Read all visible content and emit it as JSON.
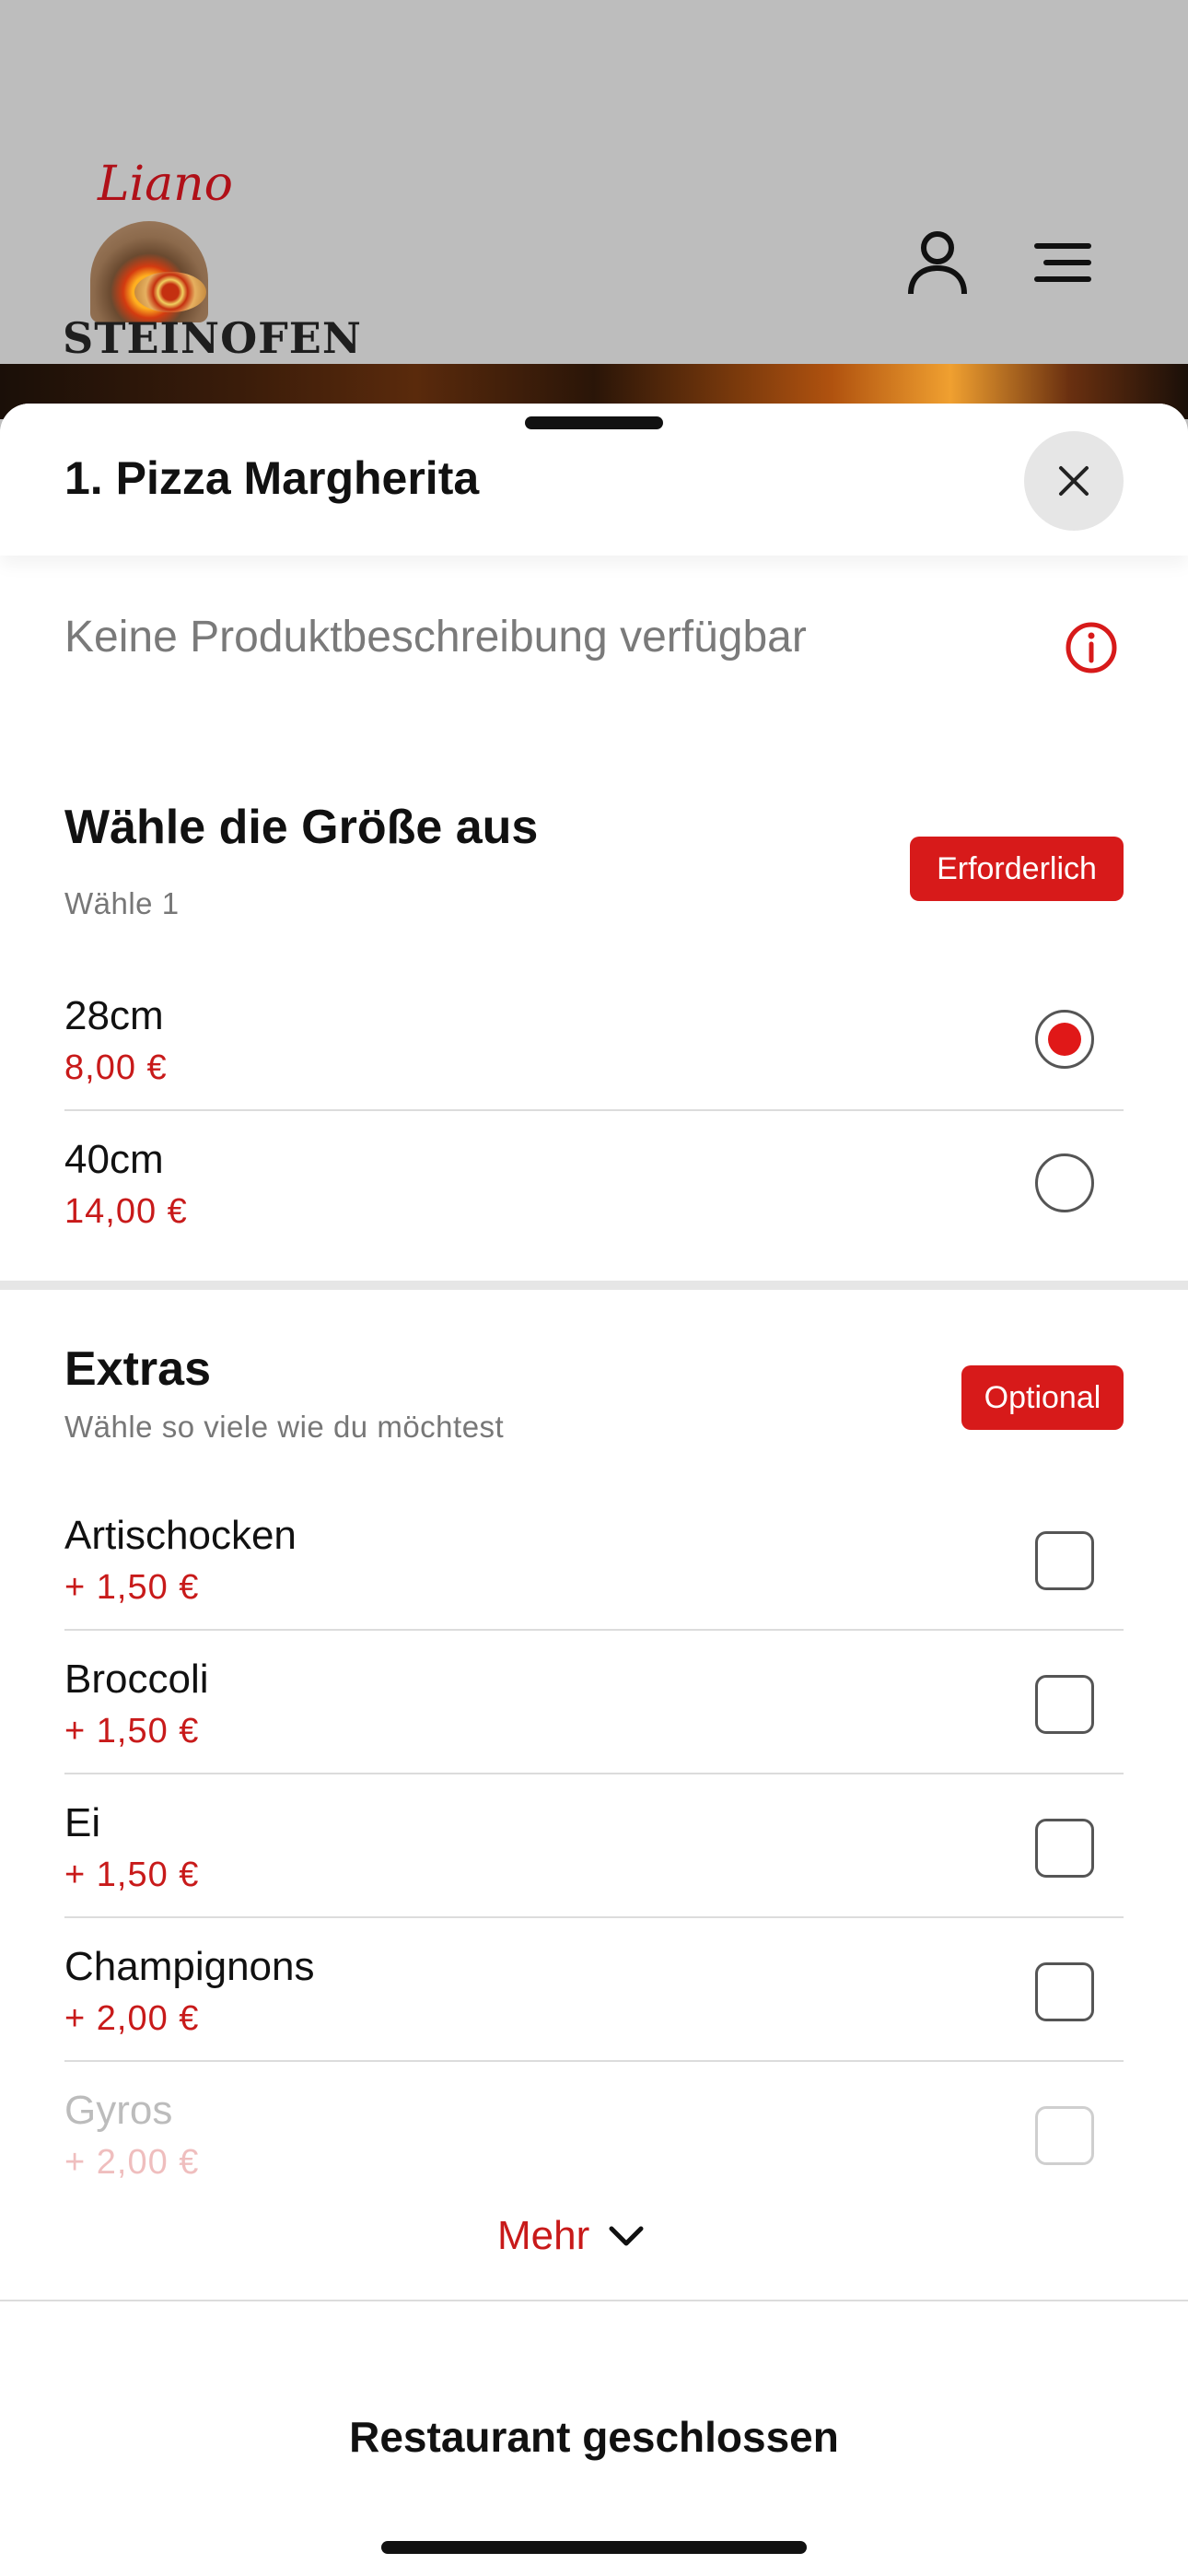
{
  "header": {
    "logo_script": "Liano",
    "logo_text": "STEINOFEN",
    "user_icon": "user-icon",
    "menu_icon": "menu-icon"
  },
  "sheet": {
    "title": "1. Pizza Margherita",
    "close_icon": "close-icon",
    "description": "Keine Produktbeschreibung verfügbar",
    "info_icon": "info-icon"
  },
  "size_group": {
    "title": "Wähle die Größe aus",
    "subtitle": "Wähle 1",
    "badge": "Erforderlich",
    "options": [
      {
        "name": "28cm",
        "price": "8,00 €",
        "selected": true
      },
      {
        "name": "40cm",
        "price": "14,00 €",
        "selected": false
      }
    ]
  },
  "extras_group": {
    "title": "Extras",
    "subtitle": "Wähle so viele wie du möchtest",
    "badge": "Optional",
    "options": [
      {
        "name": "Artischocken",
        "price": "+ 1,50 €"
      },
      {
        "name": "Broccoli",
        "price": "+ 1,50 €"
      },
      {
        "name": "Ei",
        "price": "+ 1,50 €"
      },
      {
        "name": "Champignons",
        "price": "+ 2,00 €"
      },
      {
        "name": "Gyros",
        "price": "+ 2,00 €"
      }
    ]
  },
  "more_label": "Mehr",
  "footer": {
    "status": "Restaurant geschlossen"
  },
  "colors": {
    "accent": "#d71a1a",
    "price": "#c81a1a",
    "header_bg": "#bdbdbd"
  }
}
